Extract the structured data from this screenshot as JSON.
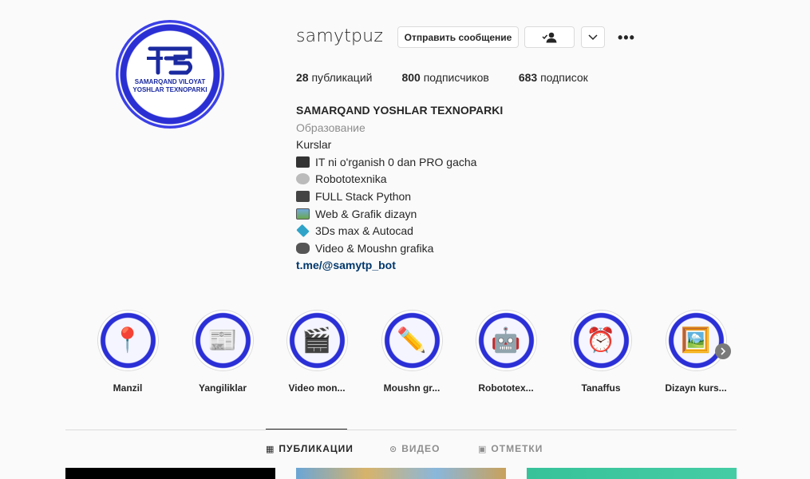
{
  "profile": {
    "username": "samytpuz",
    "avatar_line1": "SAMARQAND VILOYAT",
    "avatar_line2": "YOSHLAR TEXNOPARKI",
    "avatar_logo_icon": "tp-logo-icon"
  },
  "actions": {
    "message_label": "Отправить сообщение",
    "follow_icon": "person-check-icon",
    "dropdown_icon": "chevron-down-icon",
    "more_icon": "more-horizontal-icon"
  },
  "stats": {
    "posts_count": "28",
    "posts_label": "публикаций",
    "followers_count": "800",
    "followers_label": "подписчиков",
    "following_count": "683",
    "following_label": "подписок"
  },
  "bio": {
    "name": "SAMARQAND YOSHLAR TEXNOPARKI",
    "category": "Образование",
    "line1": "Kurslar",
    "line2": "IT ni o'rganish 0 dan PRO gacha",
    "line3": "Robototexnika",
    "line4": "FULL Stack Python",
    "line5": "Web & Grafik dizayn",
    "line6": "3Ds max & Autocad",
    "line7": "Video & Moushn grafika",
    "link": "t.me/@samytp_bot"
  },
  "highlights": [
    {
      "label": "Manzil",
      "icon": "map-pin-icon"
    },
    {
      "label": "Yangiliklar",
      "icon": "news-icon"
    },
    {
      "label": "Video mon...",
      "icon": "video-icon"
    },
    {
      "label": "Moushn gr...",
      "icon": "pencil-ruler-icon"
    },
    {
      "label": "Robototex...",
      "icon": "robot-icon"
    },
    {
      "label": "Tanaffus",
      "icon": "alarm-clock-icon"
    },
    {
      "label": "Dizayn kurs...",
      "icon": "design-tablet-icon"
    }
  ],
  "tabs": {
    "posts": "ПУБЛИКАЦИИ",
    "video": "ВИДЕО",
    "tagged": "ОТМЕТКИ"
  },
  "colors": {
    "accent_blue": "#2a2fd4",
    "link": "#00376b",
    "muted": "#8e8e8e"
  }
}
